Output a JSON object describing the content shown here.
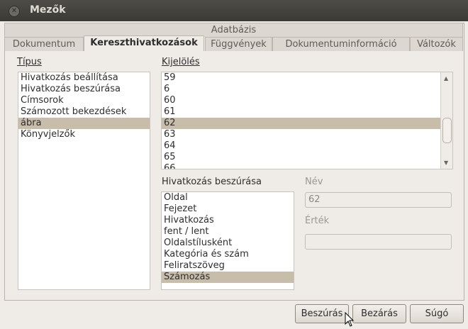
{
  "window": {
    "title": "Mezők"
  },
  "tabs_top": {
    "label": "Adatbázis"
  },
  "tabs": [
    {
      "label": "Dokumentum"
    },
    {
      "label": "Kereszthivatkozások"
    },
    {
      "label": "Függvények"
    },
    {
      "label": "Dokumentuminformáció"
    },
    {
      "label": "Változók"
    }
  ],
  "type_section": {
    "label": "Típus",
    "items": [
      "Hivatkozás beállítása",
      "Hivatkozás beszúrása",
      "Címsorok",
      "Számozott bekezdések",
      "ábra",
      "Könyvjelzők"
    ],
    "selected": "ábra"
  },
  "selection_section": {
    "label": "Kijelölés",
    "items": [
      "59",
      "6",
      "60",
      "61",
      "62",
      "63",
      "64",
      "65",
      "66"
    ],
    "selected": "62"
  },
  "insert_ref_section": {
    "label": "Hivatkozás beszúrása",
    "items": [
      "Oldal",
      "Fejezet",
      "Hivatkozás",
      "fent / lent",
      "Oldalstílusként",
      "Kategória és szám",
      "Feliratszöveg",
      "Számozás"
    ],
    "selected": "Számozás"
  },
  "name_field": {
    "label": "Név",
    "value": "62"
  },
  "value_field": {
    "label": "Érték",
    "value": ""
  },
  "buttons": {
    "insert": "Beszúrás",
    "close": "Bezárás",
    "help": "Súgó"
  }
}
